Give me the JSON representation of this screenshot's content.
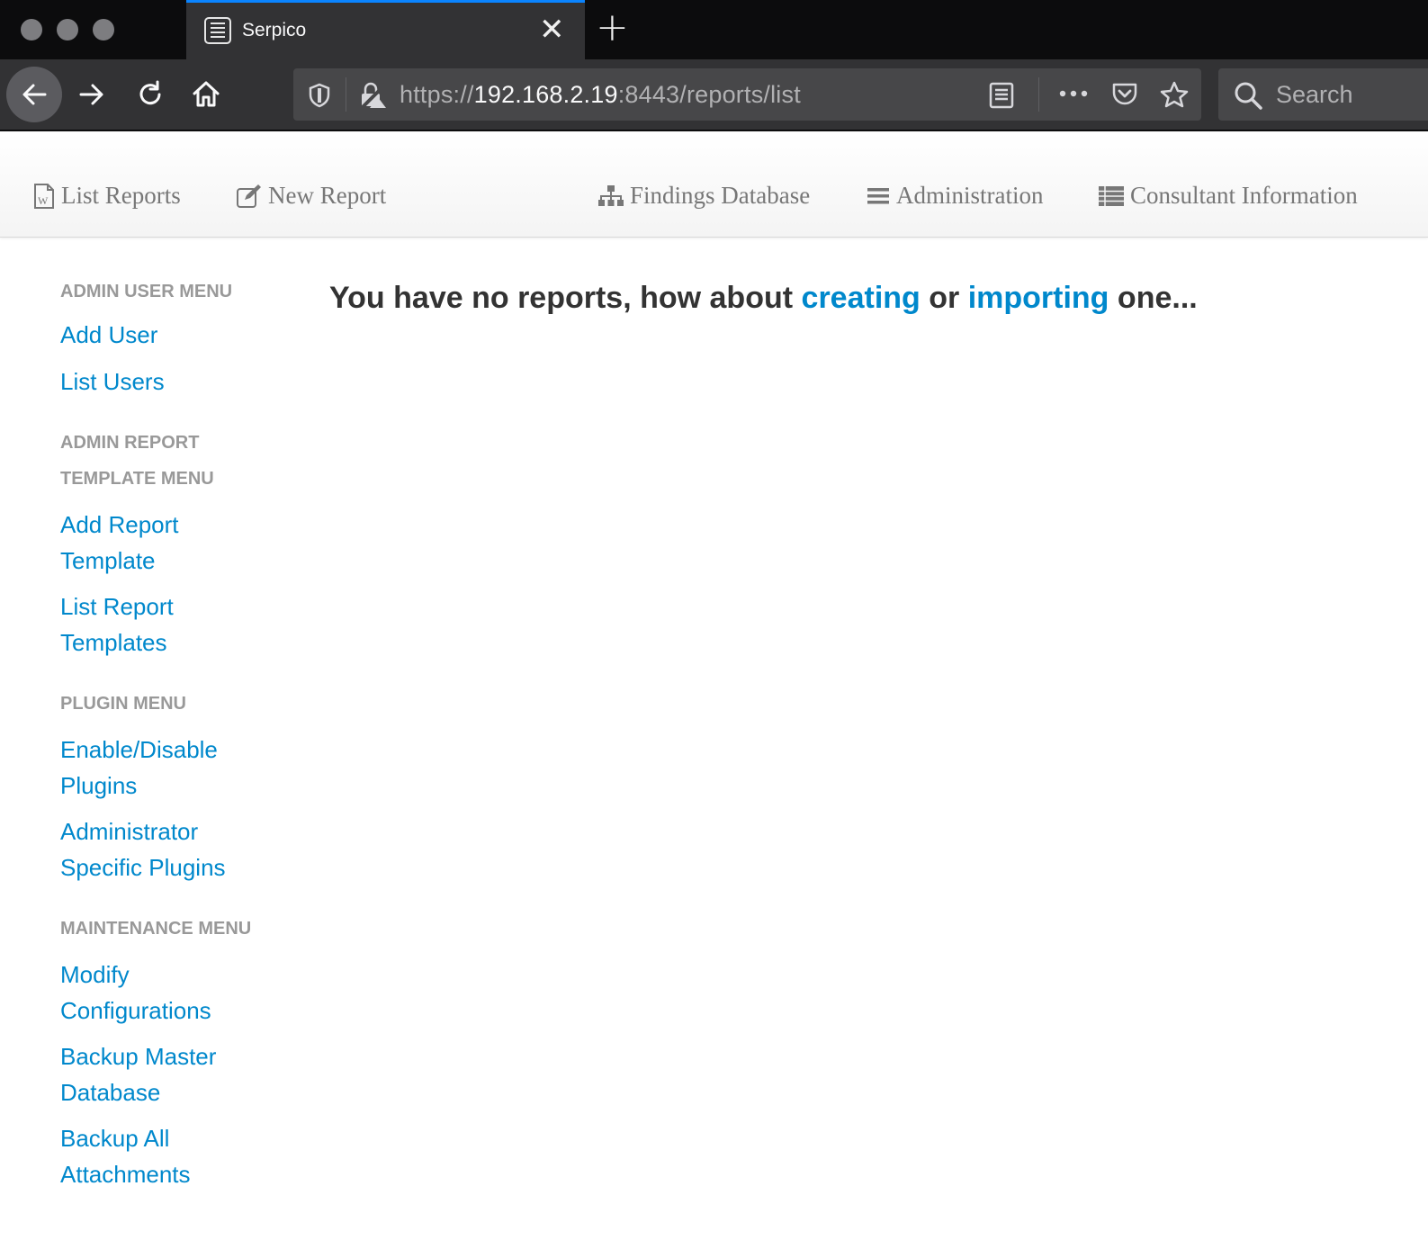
{
  "browser": {
    "tab_title": "Serpico",
    "url_scheme": "https://",
    "url_host": "192.168.2.19",
    "url_rest": ":8443/reports/list",
    "search_placeholder": "Search",
    "tab_close_glyph": "✕",
    "new_tab_glyph": "+",
    "accent_color": "#0a84ff"
  },
  "topnav": {
    "items": [
      {
        "label": "List Reports",
        "icon": "word-file-icon"
      },
      {
        "label": "New Report",
        "icon": "edit-icon"
      },
      {
        "label": "Findings Database",
        "icon": "sitemap-icon"
      },
      {
        "label": "Administration",
        "icon": "list-icon"
      },
      {
        "label": "Consultant Information",
        "icon": "table-icon"
      }
    ]
  },
  "sidebar": {
    "sections": [
      {
        "header": "ADMIN USER MENU",
        "links": [
          "Add User",
          "List Users"
        ]
      },
      {
        "header": "ADMIN REPORT TEMPLATE MENU",
        "links": [
          "Add Report Template",
          "List Report Templates"
        ]
      },
      {
        "header": "PLUGIN MENU",
        "links": [
          "Enable/Disable Plugins",
          "Administrator Specific Plugins"
        ]
      },
      {
        "header": "MAINTENANCE MENU",
        "links": [
          "Modify Configurations",
          "Backup Master Database",
          "Backup All Attachments"
        ]
      }
    ]
  },
  "main": {
    "msg_prefix": "You have no reports, how about",
    "link_creating": "creating",
    "msg_middle": "or",
    "link_importing": "importing",
    "msg_suffix": "one..."
  },
  "colors": {
    "link": "#0088cc",
    "heading": "#999999",
    "text": "#333333"
  }
}
